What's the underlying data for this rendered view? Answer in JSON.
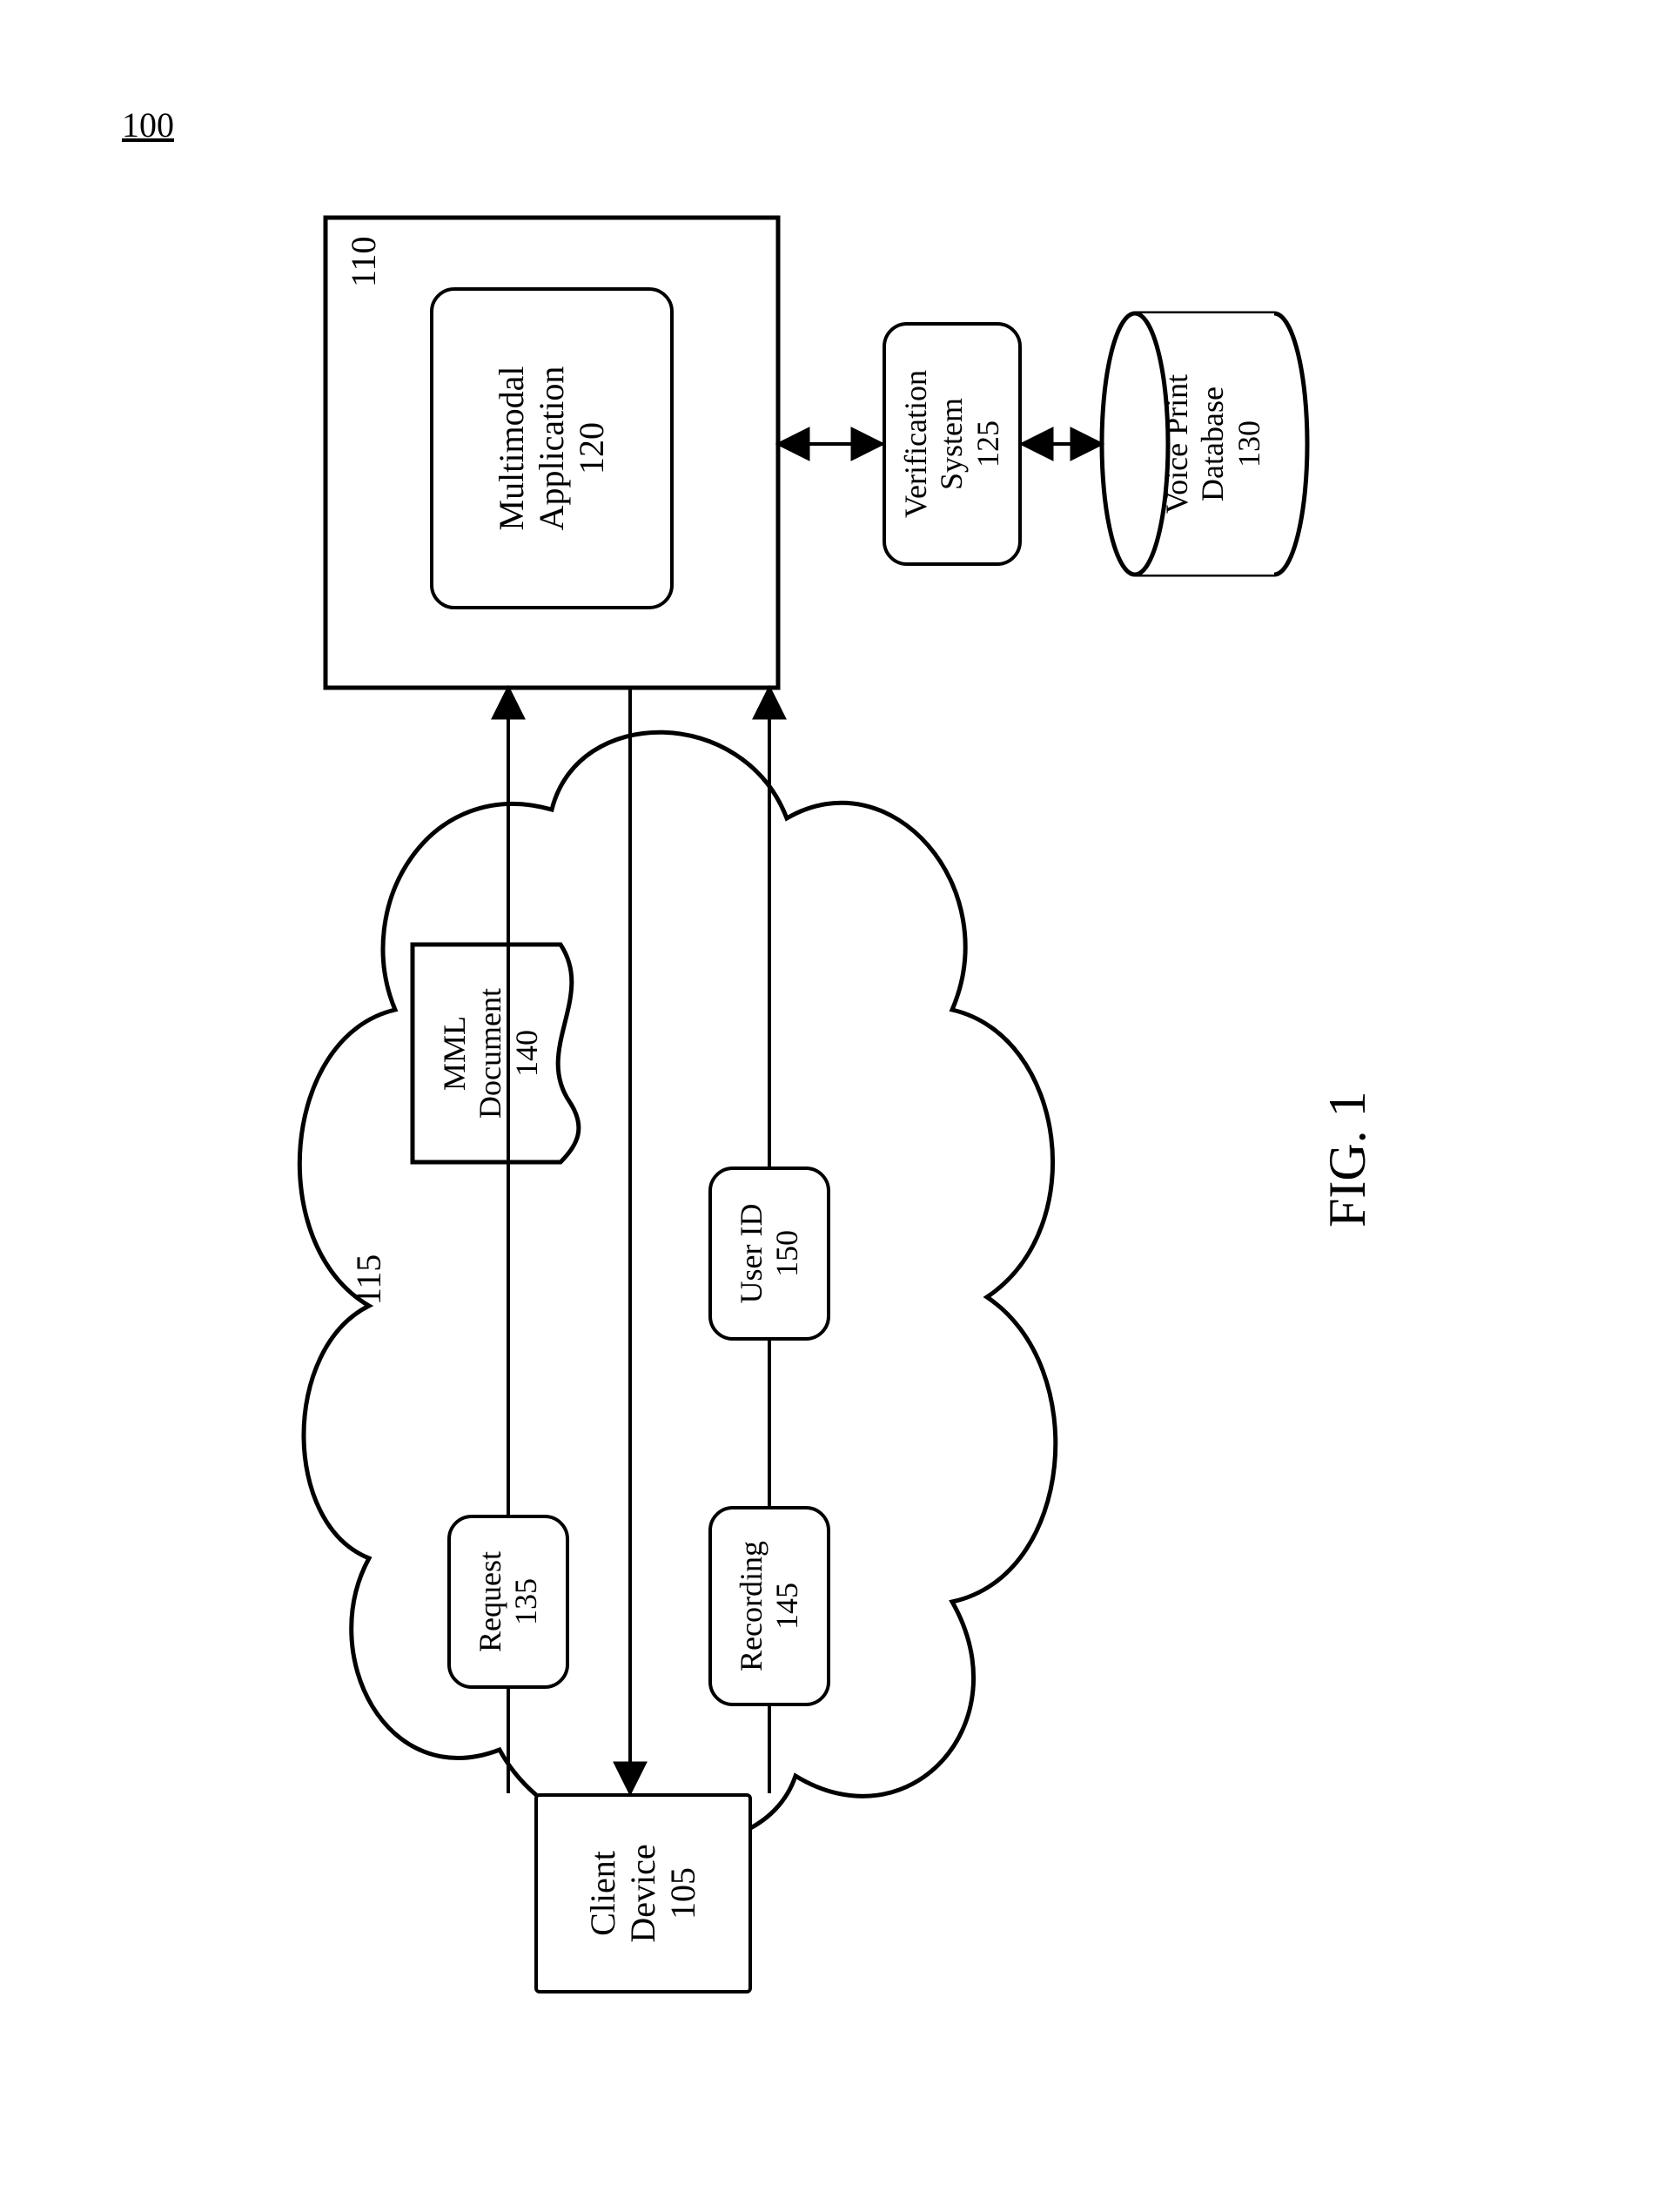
{
  "diagram_ref": "100",
  "figure_label": "FIG. 1",
  "cloud_ref": "115",
  "server_ref": "110",
  "nodes": {
    "client": {
      "line1": "Client",
      "line2": "Device",
      "ref": "105"
    },
    "request": {
      "line1": "Request",
      "line2": "",
      "ref": "135"
    },
    "mml": {
      "line1": "MML",
      "line2": "Document",
      "ref": "140"
    },
    "recording": {
      "line1": "Recording",
      "line2": "",
      "ref": "145"
    },
    "userid": {
      "line1": "User ID",
      "line2": "",
      "ref": "150"
    },
    "app": {
      "line1": "Multimodal",
      "line2": "Application",
      "ref": "120"
    },
    "verify": {
      "line1": "Verification",
      "line2": "System",
      "ref": "125"
    },
    "db": {
      "line1": "Voice Print",
      "line2": "Database",
      "ref": "130"
    }
  }
}
